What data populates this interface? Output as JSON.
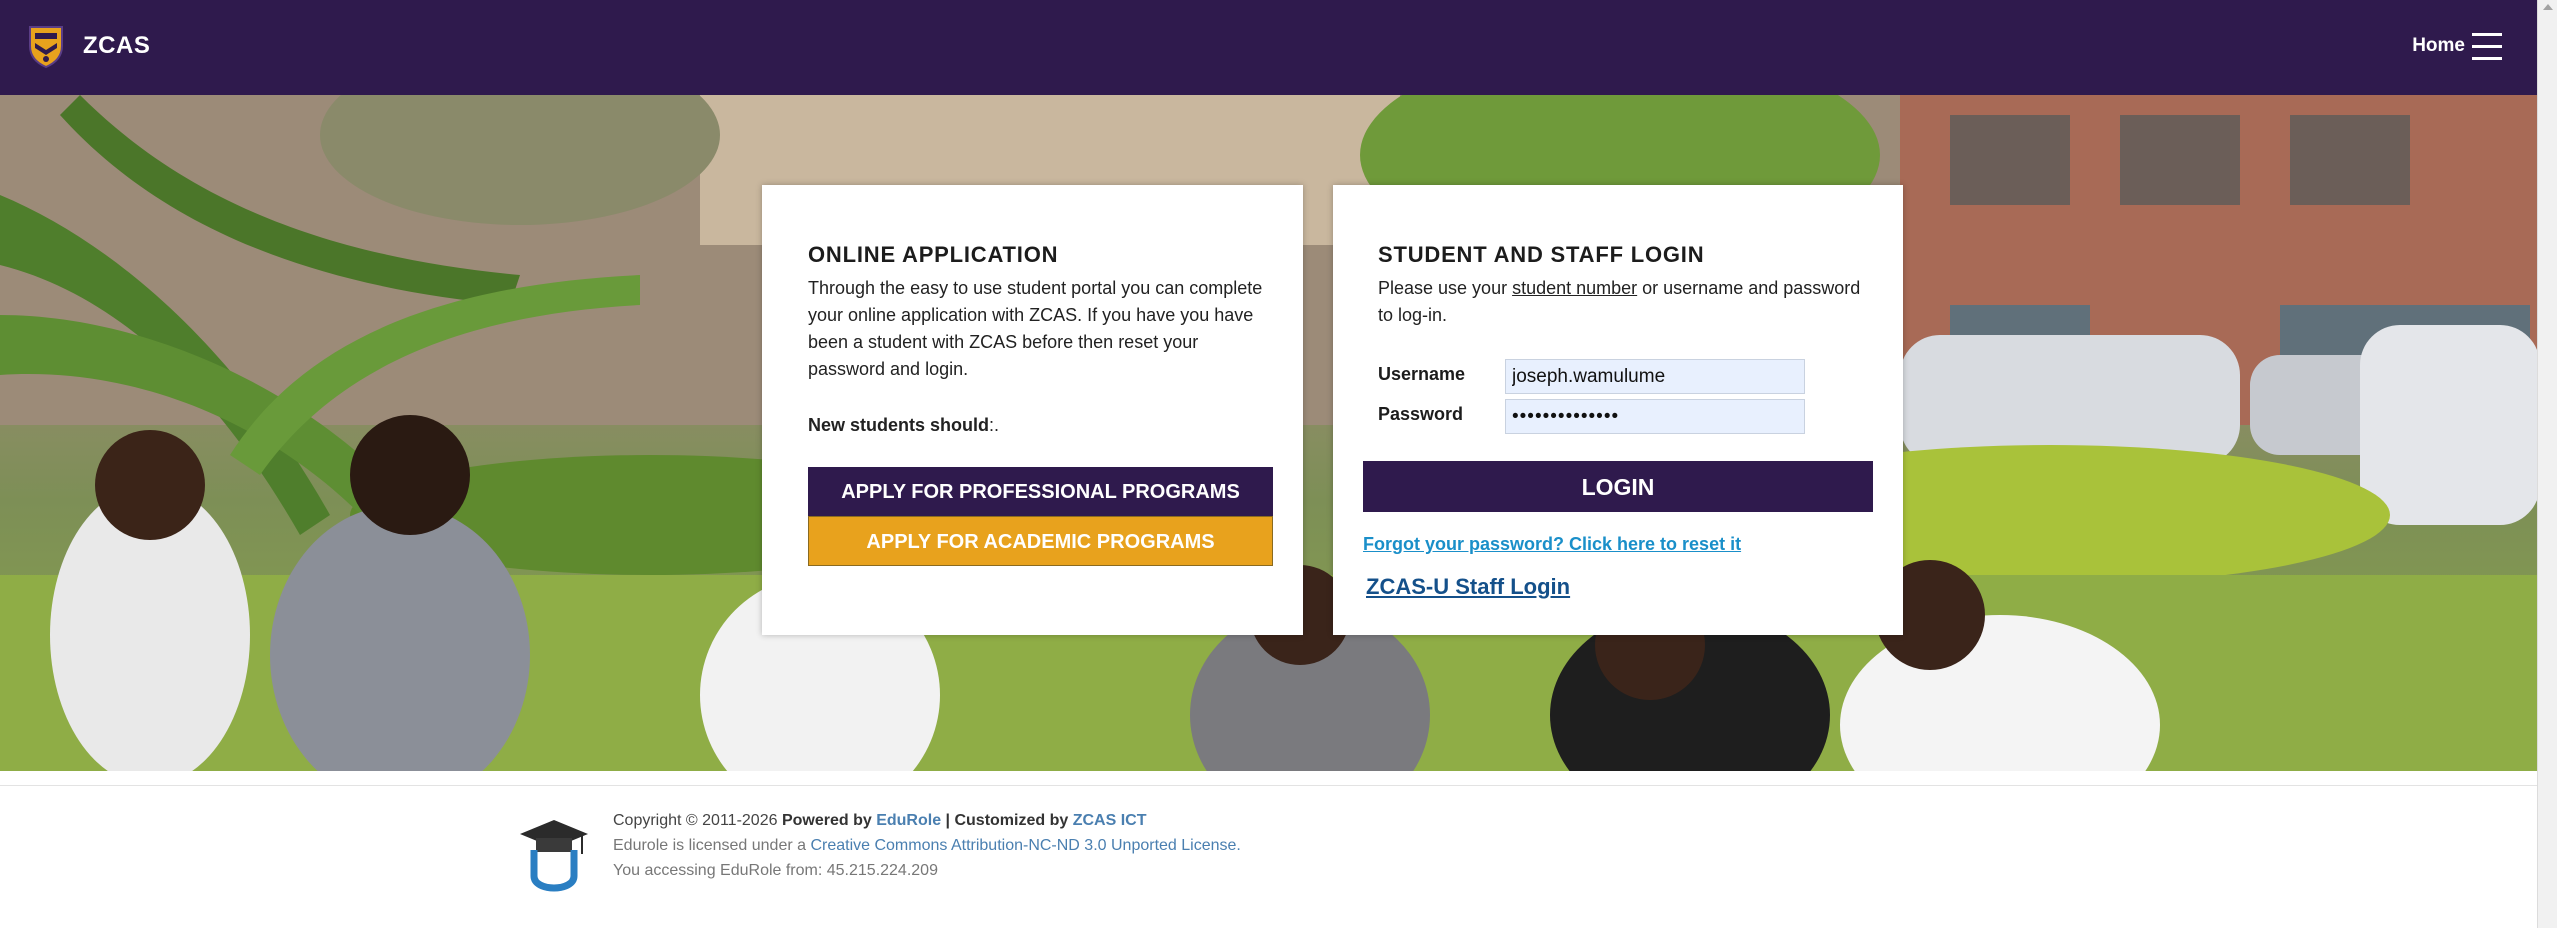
{
  "header": {
    "brand": "ZCAS",
    "nav_home": "Home",
    "colors": {
      "bar": "#2f1a4d",
      "accent": "#e8a21d"
    }
  },
  "application_card": {
    "title": "ONLINE APPLICATION",
    "description": "Through the easy to use student portal you can complete your online application with ZCAS. If you have you have been a student with ZCAS before then reset your password and login.",
    "new_students_label": "New students should",
    "new_students_tail": ":.",
    "professional_button": "APPLY FOR PROFESSIONAL PROGRAMS",
    "academic_button": "APPLY FOR ACADEMIC PROGRAMS"
  },
  "login_card": {
    "title": "STUDENT AND STAFF LOGIN",
    "desc_before": "Please use your ",
    "desc_link": "student number",
    "desc_after": " or username and password to log-in.",
    "username_label": "Username",
    "username_value": "joseph.wamulume",
    "password_label": "Password",
    "password_value": "••••••••••••••",
    "login_button": "LOGIN",
    "forgot_link": "Forgot your password? Click here to reset it",
    "staff_link": "ZCAS-U Staff Login"
  },
  "footer": {
    "copyright": "Copyright © 2011-2026 ",
    "powered_by": "Powered by",
    "edurole": "EduRole",
    "separator": " | ",
    "customized_by": "Customized by",
    "zcas_ict": "ZCAS ICT",
    "license_before": "Edurole is licensed under a ",
    "license_link": "Creative Commons Attribution-NC-ND 3.0 Unported License.",
    "access_line": "You accessing EduRole from: 45.215.224.209"
  },
  "icons": [
    "zcas-crest-icon",
    "hamburger-menu-icon",
    "edurole-graduation-cap-icon"
  ]
}
